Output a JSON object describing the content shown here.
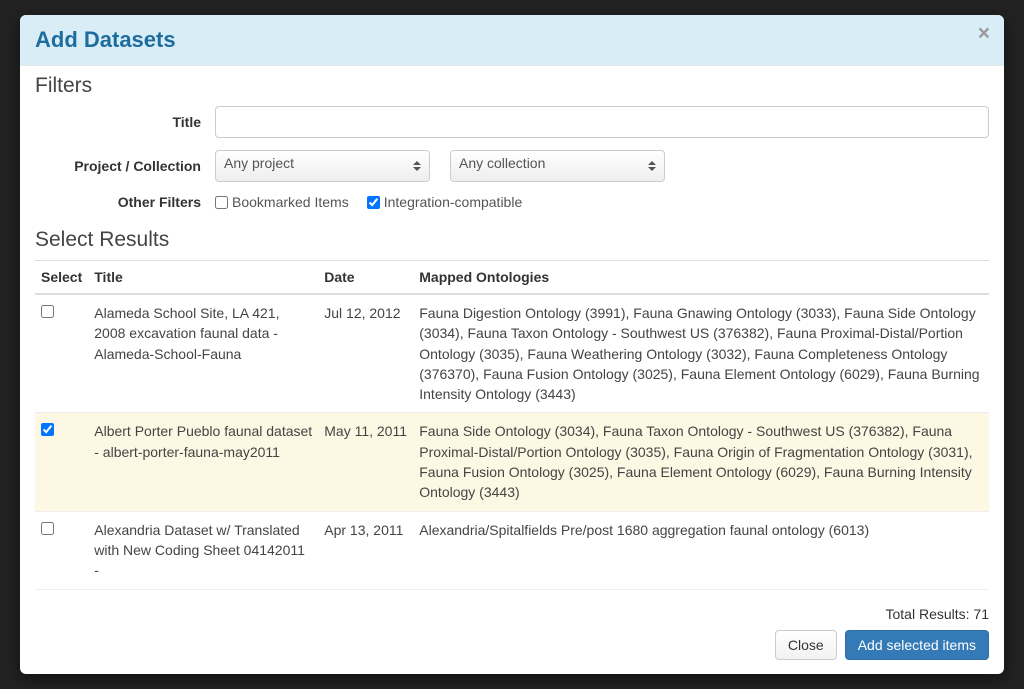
{
  "modal": {
    "title": "Add Datasets",
    "close_label": "×"
  },
  "filters": {
    "heading": "Filters",
    "title_label": "Title",
    "title_value": "",
    "project_collection_label": "Project / Collection",
    "project_select": "Any project",
    "collection_select": "Any collection",
    "other_filters_label": "Other Filters",
    "bookmarked_label": "Bookmarked Items",
    "bookmarked_checked": false,
    "integration_label": "Integration-compatible",
    "integration_checked": true
  },
  "results": {
    "heading": "Select Results",
    "columns": {
      "select": "Select",
      "title": "Title",
      "date": "Date",
      "mapped": "Mapped Ontologies"
    },
    "rows": [
      {
        "checked": false,
        "title": "Alameda School Site, LA 421, 2008 excavation faunal data - Alameda-School-Fauna",
        "date": "Jul 12, 2012",
        "mapped": "Fauna Digestion Ontology (3991), Fauna Gnawing Ontology (3033), Fauna Side Ontology (3034), Fauna Taxon Ontology - Southwest US (376382), Fauna Proximal-Distal/Portion Ontology (3035), Fauna Weathering Ontology (3032), Fauna Completeness Ontology (376370), Fauna Fusion Ontology (3025), Fauna Element Ontology (6029), Fauna Burning Intensity Ontology (3443)"
      },
      {
        "checked": true,
        "title": "Albert Porter Pueblo faunal dataset - albert-porter-fauna-may2011",
        "date": "May 11, 2011",
        "mapped": "Fauna Side Ontology (3034), Fauna Taxon Ontology - Southwest US (376382), Fauna Proximal-Distal/Portion Ontology (3035), Fauna Origin of Fragmentation Ontology (3031), Fauna Fusion Ontology (3025), Fauna Element Ontology (6029), Fauna Burning Intensity Ontology (3443)"
      },
      {
        "checked": false,
        "title": "Alexandria Dataset w/ Translated with New Coding Sheet 04142011 -",
        "date": "Apr 13, 2011",
        "mapped": "Alexandria/Spitalfields Pre/post 1680 aggregation faunal ontology (6013)"
      }
    ]
  },
  "footer": {
    "total_results_label": "Total Results: 71",
    "close_button": "Close",
    "add_button": "Add selected items"
  }
}
